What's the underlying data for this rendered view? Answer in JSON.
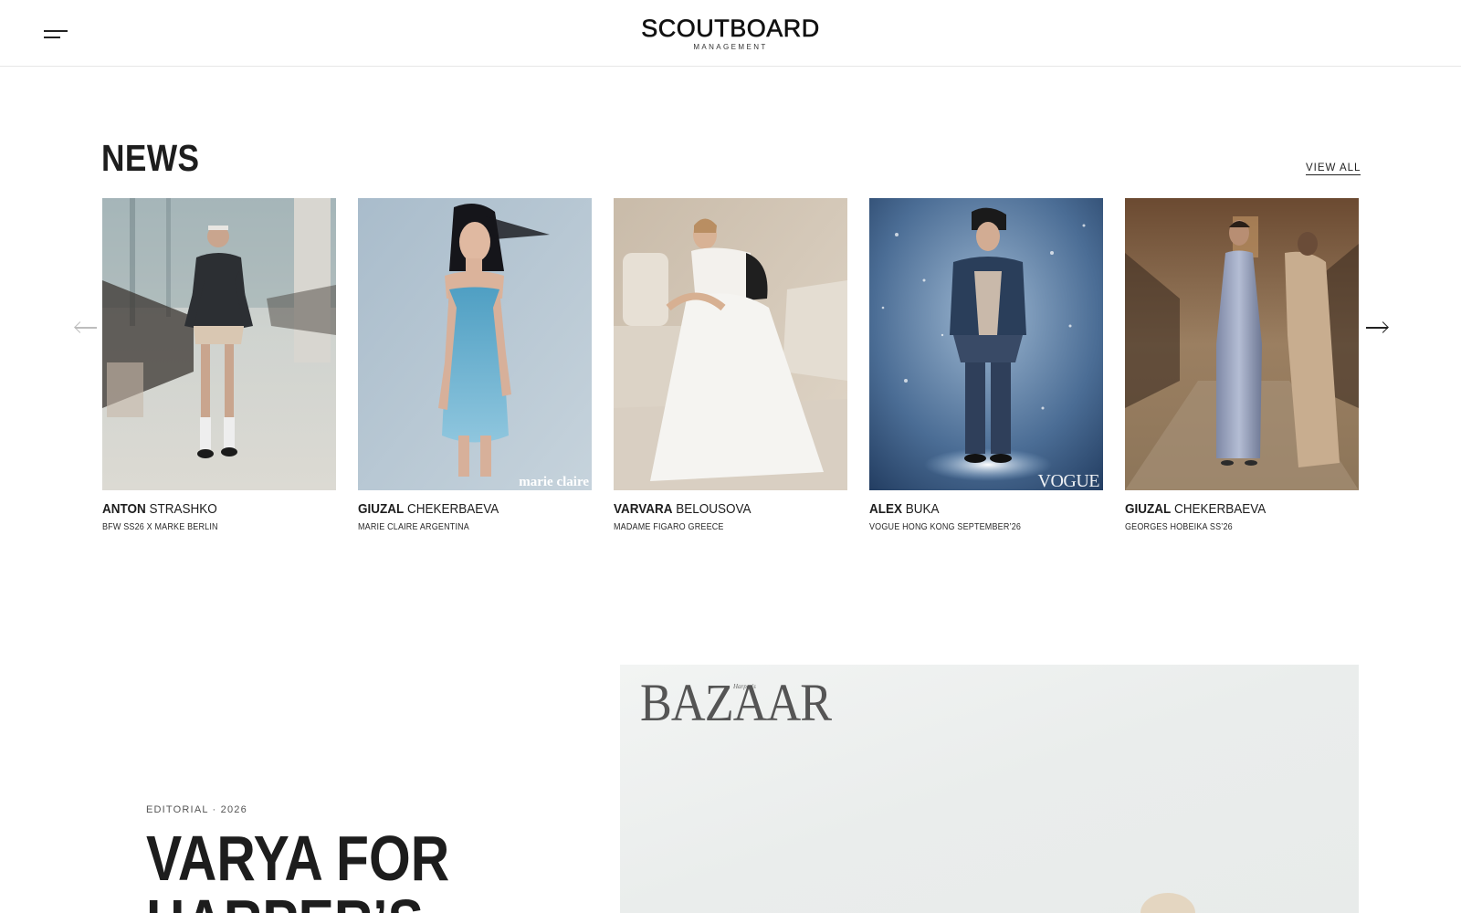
{
  "header": {
    "logo_main": "SCOUTBOARD",
    "logo_sub": "MANAGEMENT",
    "menu_icon": "hamburger-menu-icon"
  },
  "news": {
    "title": "NEWS",
    "view_all": "VIEW ALL",
    "prev_icon": "arrow-left-icon",
    "next_icon": "arrow-right-icon",
    "items": [
      {
        "first": "ANTON",
        "last": "STRASHKO",
        "caption": "BFW SS26 X MARKE BERLIN",
        "watermark": ""
      },
      {
        "first": "GIUZAL",
        "last": "CHEKERBAEVA",
        "caption": "MARIE CLAIRE ARGENTINA",
        "watermark": "marie claire"
      },
      {
        "first": "VARVARA",
        "last": "BELOUSOVA",
        "caption": "MADAME FIGARO GREECE",
        "watermark": ""
      },
      {
        "first": "ALEX",
        "last": "BUKA",
        "caption": "VOGUE HONG KONG SEPTEMBER’26",
        "watermark": "VOGUE"
      },
      {
        "first": "GIUZAL",
        "last": "CHEKERBAEVA",
        "caption": "GEORGES HOBEIKA SS’26",
        "watermark": ""
      }
    ]
  },
  "feature": {
    "eyebrow": "EDITORIAL · 2026",
    "title_line1": "VARYA FOR",
    "title_line2": "HARPER’S",
    "magazine_logo": "BAZAAR",
    "magazine_small": "Harper's"
  },
  "colors": {
    "text": "#1d1d1d",
    "muted": "#555555",
    "divider": "#e6e6e6",
    "background": "#ffffff"
  }
}
